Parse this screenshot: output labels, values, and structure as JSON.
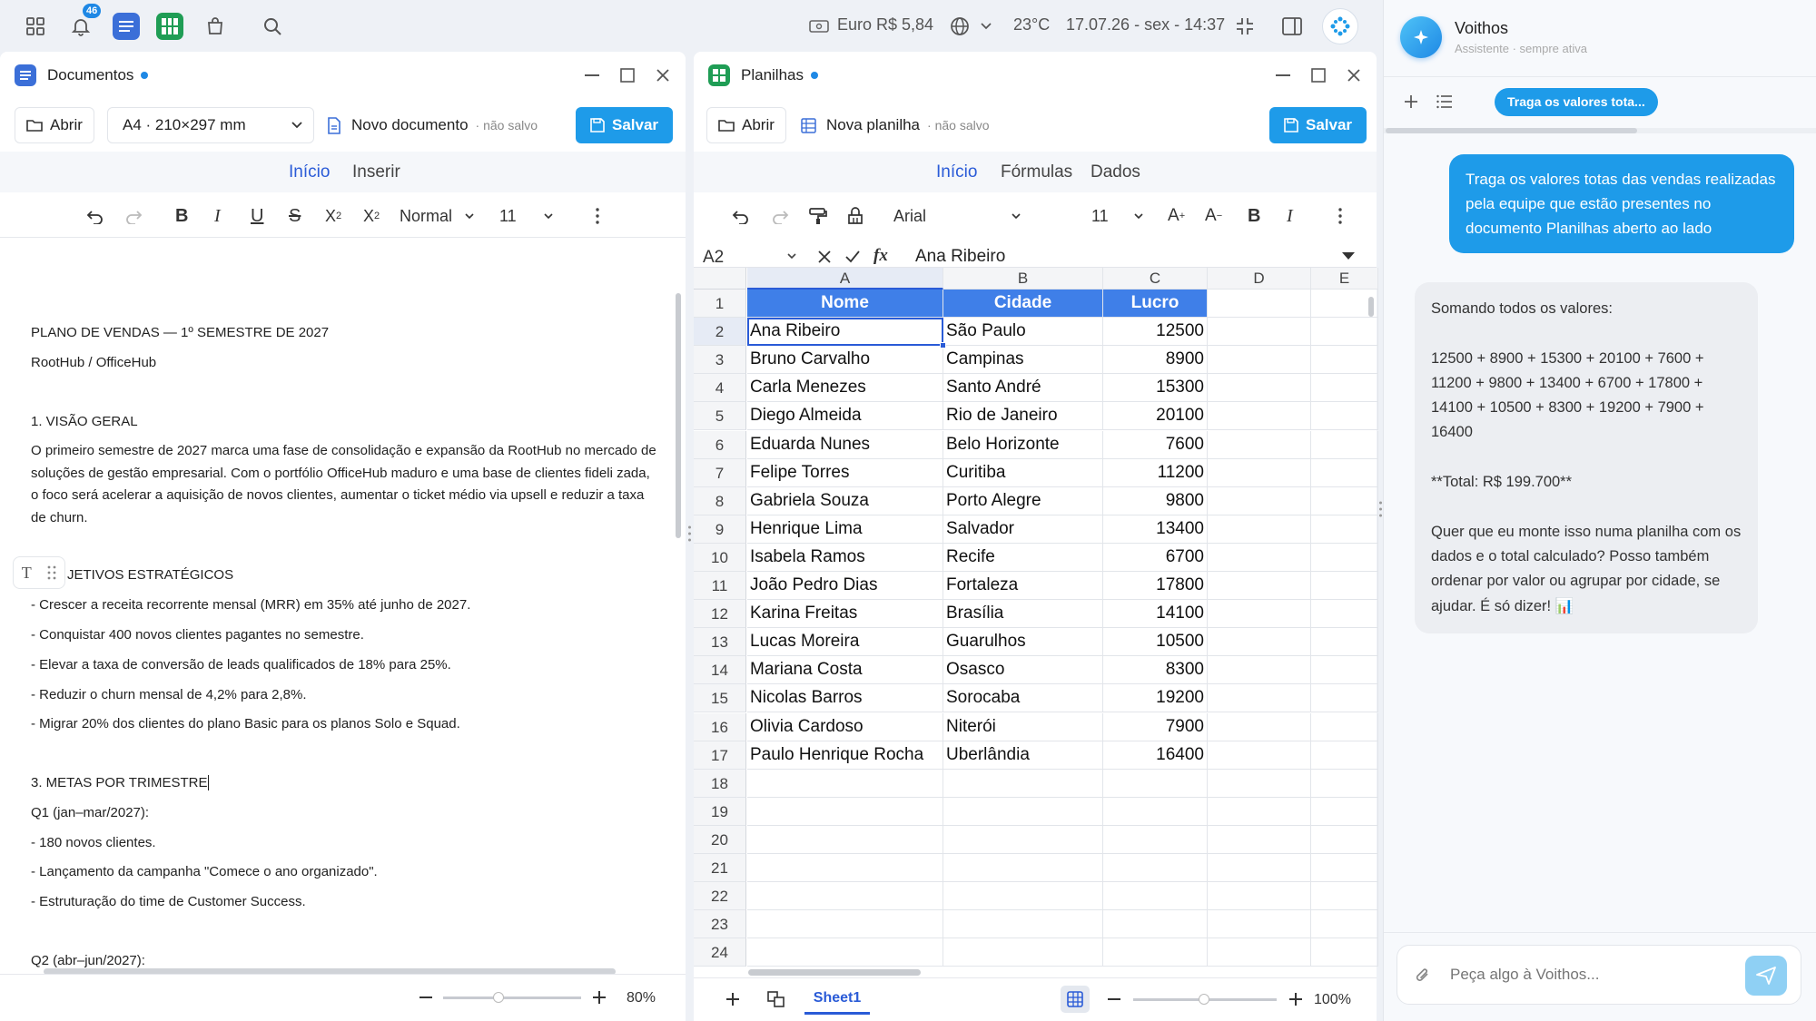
{
  "taskbar": {
    "notification_count": "46",
    "currency": "Euro R$ 5,84",
    "temperature": "23°C",
    "datetime": "17.07.26 - sex - 14:37"
  },
  "documents": {
    "title": "Documentos",
    "open_label": "Abrir",
    "page_size": "A4 · 210×297 mm",
    "doc_name": "Novo documento",
    "doc_status": "· não salvo",
    "save_label": "Salvar",
    "tabs": [
      "Início",
      "Inserir"
    ],
    "style_value": "Normal",
    "font_size": "11",
    "zoom": "80%",
    "content": {
      "title": "PLANO DE VENDAS — 1º SEMESTRE DE 2027",
      "subtitle": "RootHub / OfficeHub",
      "h1": "1. VISÃO GERAL",
      "para1": "O primeiro semestre de 2027 marca uma fase de consolidação e expansão da RootHub no mercado de soluções de gestão empresarial. Com o portfólio OfficeHub maduro e uma base de clientes fideli zada, o foco será acelerar a aquisição de novos clientes, aumentar o ticket médio via upsell e reduzir a taxa de churn.",
      "h2": "JETIVOS ESTRATÉGICOS",
      "bullets": [
        "- Crescer a receita recorrente mensal (MRR) em 35% até junho de 2027.",
        "- Conquistar 400 novos clientes pagantes no semestre.",
        "- Elevar a taxa de conversão de leads qualificados de 18% para 25%.",
        "- Reduzir o churn mensal de 4,2% para 2,8%.",
        "- Migrar 20% dos clientes do plano Basic para os planos Solo e Squad."
      ],
      "h3": "3. METAS POR TRIMESTRE",
      "q1": "Q1 (jan–mar/2027):",
      "q1_items": [
        "- 180 novos clientes.",
        "- Lançamento da campanha \"Comece o ano organizado\".",
        "- Estruturação do time de Customer Success."
      ],
      "q2": "Q2 (abr–jun/2027):"
    }
  },
  "sheets": {
    "title": "Planilhas",
    "open_label": "Abrir",
    "doc_name": "Nova planilha",
    "doc_status": "· não salvo",
    "save_label": "Salvar",
    "tabs": [
      "Início",
      "Fórmulas",
      "Dados"
    ],
    "font_name": "Arial",
    "font_size": "11",
    "cell_ref": "A2",
    "formula_value": "Ana Ribeiro",
    "fx_label": "fx",
    "columns": [
      "A",
      "B",
      "C",
      "D",
      "E"
    ],
    "headers": [
      "Nome",
      "Cidade",
      "Lucro"
    ],
    "rows": [
      [
        "Ana Ribeiro",
        "São Paulo",
        "12500"
      ],
      [
        "Bruno Carvalho",
        "Campinas",
        "8900"
      ],
      [
        "Carla Menezes",
        "Santo André",
        "15300"
      ],
      [
        "Diego Almeida",
        "Rio de Janeiro",
        "20100"
      ],
      [
        "Eduarda Nunes",
        "Belo Horizonte",
        "7600"
      ],
      [
        "Felipe Torres",
        "Curitiba",
        "11200"
      ],
      [
        "Gabriela Souza",
        "Porto Alegre",
        "9800"
      ],
      [
        "Henrique Lima",
        "Salvador",
        "13400"
      ],
      [
        "Isabela Ramos",
        "Recife",
        "6700"
      ],
      [
        "João Pedro Dias",
        "Fortaleza",
        "17800"
      ],
      [
        "Karina Freitas",
        "Brasília",
        "14100"
      ],
      [
        "Lucas Moreira",
        "Guarulhos",
        "10500"
      ],
      [
        "Mariana Costa",
        "Osasco",
        "8300"
      ],
      [
        "Nicolas Barros",
        "Sorocaba",
        "19200"
      ],
      [
        "Olivia Cardoso",
        "Niterói",
        "7900"
      ],
      [
        "Paulo Henrique Rocha",
        "Uberlândia",
        "16400"
      ]
    ],
    "row_numbers": [
      "1",
      "2",
      "3",
      "4",
      "5",
      "6",
      "7",
      "8",
      "9",
      "10",
      "11",
      "12",
      "13",
      "14",
      "15",
      "16",
      "17",
      "18",
      "19",
      "20",
      "21",
      "22",
      "23",
      "24"
    ],
    "sheet_tab": "Sheet1",
    "zoom": "100%"
  },
  "chat": {
    "assistant_name": "Voithos",
    "assistant_status": "Assistente · sempre ativa",
    "conversation_tab": "Traga os valores tota...",
    "user_message": "Traga os valores totas das vendas realizadas pela equipe que estão presentes no documento Planilhas aberto ao lado",
    "ai_message": "Somando todos os valores:\n\n12500 + 8900 + 15300 + 20100 + 7600 + 11200 + 9800 + 13400 + 6700 + 17800 + 14100 + 10500 + 8300 + 19200 + 7900 + 16400\n\n**Total: R$ 199.700**\n\nQuer que eu monte isso numa planilha com os dados e o total calculado? Posso também ordenar por valor ou agrupar por cidade, se ajudar. É só dizer! 📊",
    "input_placeholder": "Peça algo à Voithos..."
  }
}
